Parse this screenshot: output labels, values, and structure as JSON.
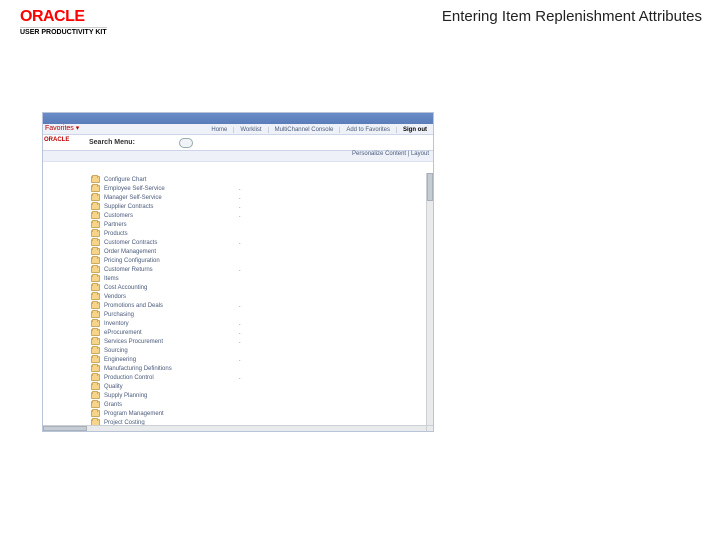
{
  "header": {
    "logo_text": "ORACLE",
    "logo_sub": "USER PRODUCTIVITY KIT",
    "page_title": "Entering Item Replenishment Attributes"
  },
  "app": {
    "oracle_left": "ORACLE",
    "search_label": "Search Menu:",
    "nav": [
      "Home",
      "Worklist",
      "MultiChannel Console",
      "Add to Favorites",
      "Sign out"
    ],
    "bar_right": "Personalize Content | Layout",
    "menu": [
      {
        "label": "Configure Chart",
        "dot": ""
      },
      {
        "label": "Employee Self-Service",
        "dot": "."
      },
      {
        "label": "Manager Self-Service",
        "dot": "."
      },
      {
        "label": "Supplier Contracts",
        "dot": "."
      },
      {
        "label": "Customers",
        "dot": "."
      },
      {
        "label": "Partners",
        "dot": ""
      },
      {
        "label": "Products",
        "dot": ""
      },
      {
        "label": "Customer Contracts",
        "dot": "."
      },
      {
        "label": "Order Management",
        "dot": ""
      },
      {
        "label": "Pricing Configuration",
        "dot": ""
      },
      {
        "label": "Customer Returns",
        "dot": "."
      },
      {
        "label": "Items",
        "dot": ""
      },
      {
        "label": "Cost Accounting",
        "dot": ""
      },
      {
        "label": "Vendors",
        "dot": ""
      },
      {
        "label": "Promotions and Deals",
        "dot": "."
      },
      {
        "label": "Purchasing",
        "dot": ""
      },
      {
        "label": "Inventory",
        "dot": "."
      },
      {
        "label": "eProcurement",
        "dot": "."
      },
      {
        "label": "Services Procurement",
        "dot": "."
      },
      {
        "label": "Sourcing",
        "dot": ""
      },
      {
        "label": "Engineering",
        "dot": "."
      },
      {
        "label": "Manufacturing Definitions",
        "dot": ""
      },
      {
        "label": "Production Control",
        "dot": "."
      },
      {
        "label": "Quality",
        "dot": ""
      },
      {
        "label": "Supply Planning",
        "dot": ""
      },
      {
        "label": "Grants",
        "dot": ""
      },
      {
        "label": "Program Management",
        "dot": ""
      },
      {
        "label": "Project Costing",
        "dot": ""
      }
    ]
  }
}
